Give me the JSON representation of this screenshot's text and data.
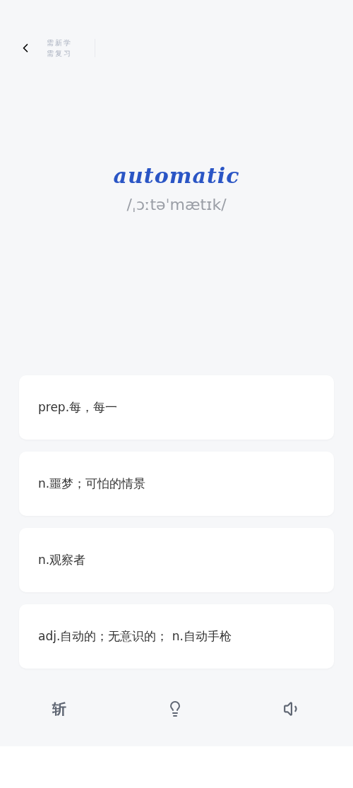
{
  "header": {
    "stats": [
      "需新学",
      "需复习"
    ]
  },
  "word": {
    "text": "automatic",
    "phonetic": "/ˌɔːtəˈmætɪk/"
  },
  "options": [
    {
      "text": "prep.每，每一"
    },
    {
      "text": "n.噩梦；可怕的情景"
    },
    {
      "text": "n.观察者"
    },
    {
      "text": "adj.自动的；无意识的； n.自动手枪"
    }
  ],
  "toolbar": {
    "cut_label": "斩"
  }
}
